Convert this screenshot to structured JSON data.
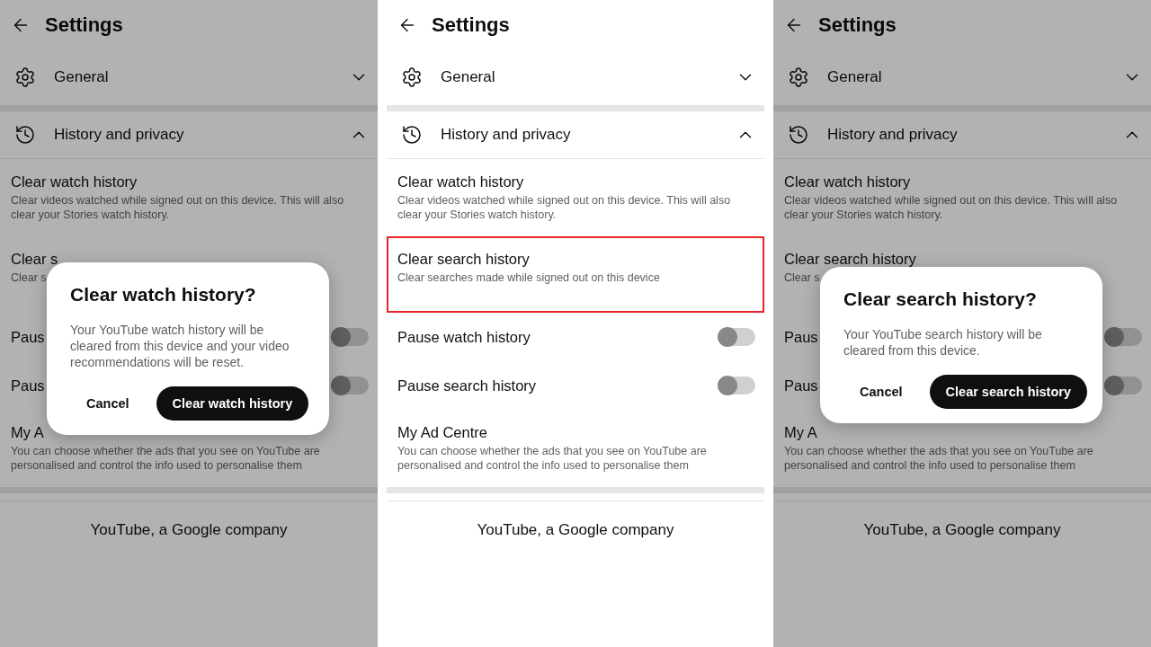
{
  "screens": [
    {
      "title": "Settings",
      "sections": [
        {
          "label": "General",
          "expanded": false
        },
        {
          "label": "History and privacy",
          "expanded": true
        }
      ],
      "items": [
        {
          "kind": "action",
          "title": "Clear watch history",
          "description": "Clear videos watched while signed out on this device. This will also clear your Stories watch history.",
          "highlighted": false
        },
        {
          "kind": "action",
          "title": "Clear s",
          "description": "Clear s",
          "highlighted": false
        },
        {
          "kind": "toggle",
          "title": "Paus",
          "on": false
        },
        {
          "kind": "toggle",
          "title": "Paus",
          "on": false
        },
        {
          "kind": "action",
          "title": "My A",
          "description": "You can choose whether the ads that you see on YouTube are personalised and control the info used to personalise them",
          "highlighted": false
        }
      ],
      "footer": "YouTube, a Google company",
      "dialog": {
        "title": "Clear watch history?",
        "message": "Your YouTube watch history will be cleared from this device and your video recommendations will be reset.",
        "cancel": "Cancel",
        "confirm": "Clear watch history"
      }
    },
    {
      "title": "Settings",
      "sections": [
        {
          "label": "General",
          "expanded": false
        },
        {
          "label": "History and privacy",
          "expanded": true
        }
      ],
      "items": [
        {
          "kind": "action",
          "title": "Clear watch history",
          "description": "Clear videos watched while signed out on this device. This will also clear your Stories watch history.",
          "highlighted": false
        },
        {
          "kind": "action",
          "title": "Clear search history",
          "description": "Clear searches made while signed out on this device",
          "highlighted": true
        },
        {
          "kind": "toggle",
          "title": "Pause watch history",
          "on": false
        },
        {
          "kind": "toggle",
          "title": "Pause search history",
          "on": false
        },
        {
          "kind": "action",
          "title": "My Ad Centre",
          "description": "You can choose whether the ads that you see on YouTube are personalised and control the info used to personalise them",
          "highlighted": false
        }
      ],
      "footer": "YouTube, a Google company"
    },
    {
      "title": "Settings",
      "sections": [
        {
          "label": "General",
          "expanded": false
        },
        {
          "label": "History and privacy",
          "expanded": true
        }
      ],
      "items": [
        {
          "kind": "action",
          "title": "Clear watch history",
          "description": "Clear videos watched while signed out on this device. This will also clear your Stories watch history.",
          "highlighted": false
        },
        {
          "kind": "action",
          "title": "Clear search history",
          "description": "Clear s",
          "highlighted": false
        },
        {
          "kind": "toggle",
          "title": "Paus",
          "on": false
        },
        {
          "kind": "toggle",
          "title": "Paus",
          "on": false
        },
        {
          "kind": "action",
          "title": "My A",
          "description": "You can choose whether the ads that you see on YouTube are personalised and control the info used to personalise them",
          "highlighted": false
        }
      ],
      "footer": "YouTube, a Google company",
      "dialog": {
        "title": "Clear search history?",
        "message": "Your YouTube search history will be cleared from this device.",
        "cancel": "Cancel",
        "confirm": "Clear search history"
      }
    }
  ]
}
